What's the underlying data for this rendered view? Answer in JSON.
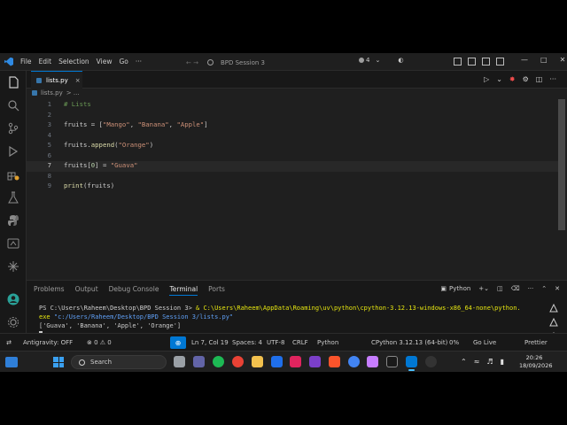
{
  "titlebar": {
    "menu": [
      "File",
      "Edit",
      "Selection",
      "View",
      "Go",
      "···"
    ],
    "nav": "← →",
    "command_center": "BPD Session 3",
    "copilot_count": "4"
  },
  "tab": {
    "label": "lists.py",
    "close": "×"
  },
  "breadcrumb": {
    "file": "lists.py",
    "sep": "> ..."
  },
  "code_lines": [
    {
      "num": "1",
      "text": "# Lists"
    },
    {
      "num": "2",
      "text": ""
    },
    {
      "num": "3",
      "text": "fruits = [\"Mango\", \"Banana\", \"Apple\"]"
    },
    {
      "num": "4",
      "text": ""
    },
    {
      "num": "5",
      "text": "fruits.append(\"Orange\")"
    },
    {
      "num": "6",
      "text": ""
    },
    {
      "num": "7",
      "text": "fruits[0] = \"Guava\""
    },
    {
      "num": "8",
      "text": ""
    },
    {
      "num": "9",
      "text": "print(fruits)"
    }
  ],
  "panel": {
    "tabs": [
      "Problems",
      "Output",
      "Debug Console",
      "Terminal",
      "Ports"
    ],
    "selected_tab": "Terminal",
    "shell_label": "Python",
    "terminal_prompt": "PS C:\\Users\\Raheem\\Desktop\\BPD Session 3> ",
    "terminal_cmd_1": "& C:\\Users\\Raheem\\AppData\\Roaming\\uv\\python\\cpython-3.12.13-windows-x86_64-none\\python.",
    "terminal_cmd_2a": "exe ",
    "terminal_cmd_2b": "\"c:/Users/Raheem/Desktop/BPD Session 3/lists.py\"",
    "terminal_output": "['Guava', 'Banana', 'Apple', 'Orange']"
  },
  "status": {
    "antigravity": "Antigravity: OFF",
    "problems": "⊗ 0 ⚠ 0",
    "position": "Ln 7, Col 19",
    "spaces": "Spaces: 4",
    "encoding": "UTF-8",
    "eol": "CRLF",
    "language": "Python",
    "interpreter": "CPython 3.12.13 (64-bit)",
    "percent": "0%",
    "golive": "Go Live",
    "prettier": "Prettier"
  },
  "taskbar": {
    "search_placeholder": "Search",
    "time": "20:26",
    "date": "18/09/2026"
  },
  "colors": {
    "accent": "#0078d4",
    "editor_bg": "#1f1f1f",
    "keyword_string": "#ce9178",
    "comment": "#6a9955"
  }
}
